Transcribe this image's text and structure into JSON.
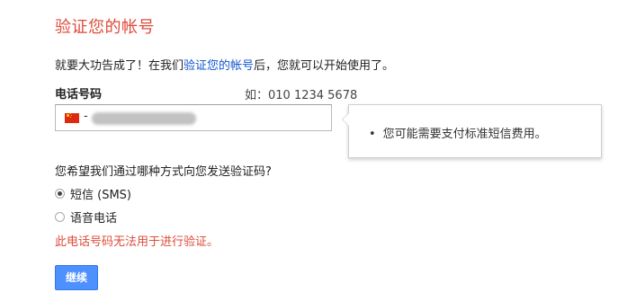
{
  "title": "验证您的帐号",
  "intro": {
    "before": "就要大功告成了！在我们",
    "link": "验证您的帐号",
    "after": "后，您就可以开始使用了。"
  },
  "phone": {
    "label": "电话号码",
    "example": "如：010 1234 5678",
    "dash": "-",
    "flag_icon": "china-flag-icon"
  },
  "tooltip": {
    "bullet": "•",
    "text": "您可能需要支付标准短信费用。"
  },
  "question": "您希望我们通过哪种方式向您发送验证码?",
  "options": [
    {
      "label": "短信 (SMS)",
      "checked": true
    },
    {
      "label": "语音电话",
      "checked": false
    }
  ],
  "error": "此电话号码无法用于进行验证。",
  "continue_label": "继续",
  "colors": {
    "title": "#dd4b39",
    "link": "#1155cc",
    "error": "#dd4b39",
    "button": "#4d90fe"
  }
}
